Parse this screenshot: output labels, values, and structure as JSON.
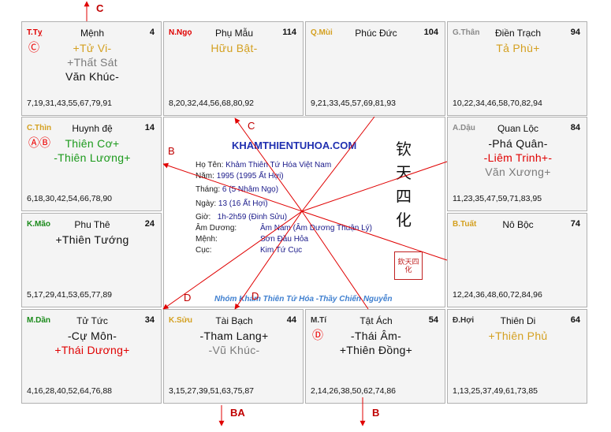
{
  "palaces": [
    {
      "id": "ty",
      "can_chi": "T.Tỵ",
      "cc_color": "#e00000",
      "name": "Mệnh",
      "num": "4",
      "marker": "Ⓒ",
      "stars": [
        {
          "t": "+Tử Vi-",
          "c": "gold"
        },
        {
          "t": "+Thất Sát",
          "c": "gray"
        },
        {
          "t": "Văn Khúc-",
          "c": "black"
        }
      ],
      "ages": "7,19,31,43,55,67,79,91"
    },
    {
      "id": "ngo",
      "can_chi": "N.Ngọ",
      "cc_color": "#e00000",
      "name": "Phụ Mẫu",
      "num": "114",
      "marker": "",
      "stars": [
        {
          "t": "Hữu Bật-",
          "c": "gold"
        }
      ],
      "ages": "8,20,32,44,56,68,80,92"
    },
    {
      "id": "mui",
      "can_chi": "Q.Mùi",
      "cc_color": "#d4a020",
      "name": "Phúc Đức",
      "num": "104",
      "marker": "",
      "stars": [],
      "ages": "9,21,33,45,57,69,81,93"
    },
    {
      "id": "than",
      "can_chi": "G.Thân",
      "cc_color": "#8a8a8a",
      "name": "Điền Trạch",
      "num": "94",
      "marker": "",
      "stars": [
        {
          "t": "Tả Phù+",
          "c": "gold"
        }
      ],
      "ages": "10,22,34,46,58,70,82,94"
    },
    {
      "id": "thin",
      "can_chi": "C.Thìn",
      "cc_color": "#d4a020",
      "name": "Huynh đệ",
      "num": "14",
      "marker": "ⒶⒷ",
      "stars": [
        {
          "t": "Thiên Cơ+",
          "c": "green"
        },
        {
          "t": "-Thiên Lương+",
          "c": "green"
        }
      ],
      "ages": "6,18,30,42,54,66,78,90"
    },
    {
      "id": "dau",
      "can_chi": "A.Dậu",
      "cc_color": "#8a8a8a",
      "name": "Quan Lộc",
      "num": "84",
      "marker": "",
      "stars": [
        {
          "t": "-Phá Quân-",
          "c": "black"
        },
        {
          "t": "-Liêm Trinh+-",
          "c": "red"
        },
        {
          "t": "Văn Xương+",
          "c": "gray"
        }
      ],
      "ages": "11,23,35,47,59,71,83,95"
    },
    {
      "id": "mao",
      "can_chi": "K.Mão",
      "cc_color": "#1a8a1a",
      "name": "Phu Thê",
      "num": "24",
      "marker": "",
      "stars": [
        {
          "t": "+Thiên Tướng",
          "c": "black"
        }
      ],
      "ages": "5,17,29,41,53,65,77,89"
    },
    {
      "id": "tuat",
      "can_chi": "B.Tuất",
      "cc_color": "#d4a020",
      "name": "Nô Bộc",
      "num": "74",
      "marker": "",
      "stars": [],
      "ages": "12,24,36,48,60,72,84,96"
    },
    {
      "id": "dan",
      "can_chi": "M.Dần",
      "cc_color": "#1a8a1a",
      "name": "Tử Tức",
      "num": "34",
      "marker": "",
      "stars": [
        {
          "t": "-Cự Môn-",
          "c": "black"
        },
        {
          "t": "+Thái Dương+",
          "c": "red"
        }
      ],
      "ages": "4,16,28,40,52,64,76,88"
    },
    {
      "id": "suu",
      "can_chi": "K.Sửu",
      "cc_color": "#d4a020",
      "name": "Tài Bạch",
      "num": "44",
      "marker": "",
      "stars": [
        {
          "t": "-Tham Lang+",
          "c": "black"
        },
        {
          "t": "-Vũ Khúc-",
          "c": "gray"
        }
      ],
      "ages": "3,15,27,39,51,63,75,87"
    },
    {
      "id": "ti",
      "can_chi": "M.Tí",
      "cc_color": "#333333",
      "name": "Tật Ách",
      "num": "54",
      "marker": "Ⓓ",
      "stars": [
        {
          "t": "-Thái Âm-",
          "c": "black"
        },
        {
          "t": "+Thiên Đồng+",
          "c": "black"
        }
      ],
      "ages": "2,14,26,38,50,62,74,86"
    },
    {
      "id": "hoi",
      "can_chi": "Đ.Hợi",
      "cc_color": "#333333",
      "name": "Thiên Di",
      "num": "64",
      "marker": "",
      "stars": [
        {
          "t": "+Thiên Phủ",
          "c": "gold"
        }
      ],
      "ages": "1,13,25,37,49,61,73,85"
    }
  ],
  "center": {
    "site_title": "KHAMTHIENTUHOA.COM",
    "rows": [
      {
        "label": "Họ Tên:",
        "value": "Khảm Thiên Tứ Hóa Việt Nam"
      },
      {
        "label": "Năm:",
        "value": "1995  (1995 Ất Hợi)"
      },
      {
        "label": "Tháng:",
        "value": "6  (5 Nhâm Ngọ)"
      },
      {
        "label": "Ngày:",
        "value": "13  (16 Ất Hợi)"
      },
      {
        "label": "Giờ:",
        "value": "1h-2h59 (Đinh Sửu)"
      },
      {
        "label": "Âm Dương:",
        "value": "Âm Nam (Âm Dương Thuận Lý)"
      },
      {
        "label": "Mệnh:",
        "value": "Sơn Đầu Hỏa"
      },
      {
        "label": "Cục:",
        "value": "Kim Tứ Cục"
      }
    ],
    "vertical_chars": [
      "钦",
      "天",
      "四",
      "化"
    ],
    "seal_text": "欽天四化",
    "group_text": "Nhóm Khảm Thiên Tứ Hóa -Thầy Chiến Nguyễn"
  },
  "arrow_labels": {
    "top": "C",
    "c_mid": "C",
    "b_left": "B",
    "d_left": "D",
    "d_mid": "D",
    "ba_bottom": "BA",
    "b_bottom": "B"
  },
  "colors": {
    "arrow": "#e00000",
    "border": "#b0b0b0",
    "cell_bg": "#f4f4f4"
  }
}
